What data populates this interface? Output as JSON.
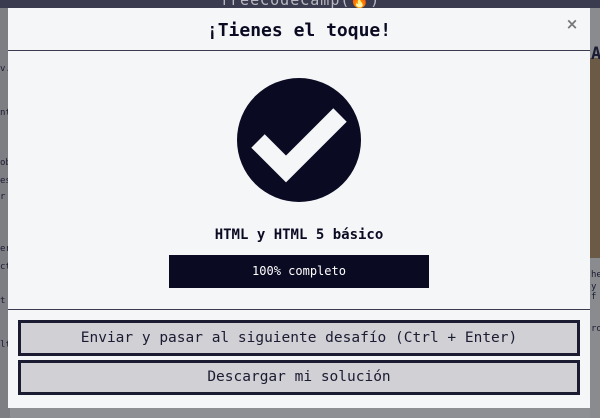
{
  "background": {
    "brand": "freeCodeCamp(🔥)",
    "left_fragments": [
      "v.",
      "nt",
      "ob",
      "es",
      "r",
      "er",
      "ct",
      "t",
      "lt"
    ],
    "right_fragments": [
      "A",
      "he",
      "y f",
      "ro"
    ]
  },
  "modal": {
    "title": "¡Tienes el toque!",
    "close_glyph": "×",
    "course_title": "HTML y HTML 5 básico",
    "progress": {
      "percent": 100,
      "label": "100% completo"
    },
    "buttons": {
      "submit_label": "Enviar y pasar al siguiente desafío (Ctrl + Enter)",
      "download_label": "Descargar mi solución"
    },
    "icon": "check-circle-icon"
  },
  "colors": {
    "primary": "#0a0a23",
    "button_bg": "#d0d0d5",
    "modal_bg": "#f5f6f7"
  }
}
